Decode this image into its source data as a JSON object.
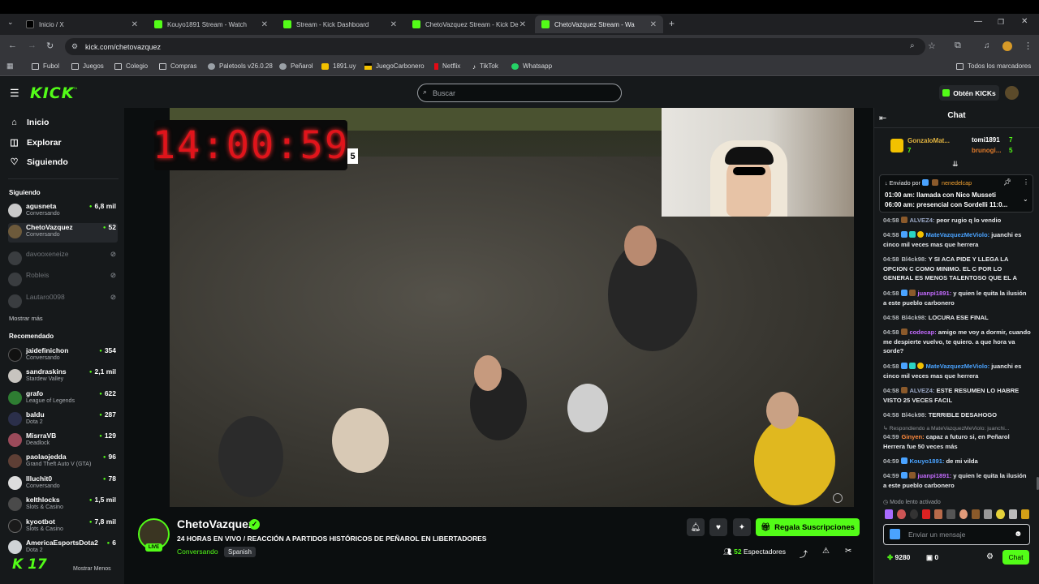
{
  "browser": {
    "tabs": [
      {
        "label": "Inicio / X"
      },
      {
        "label": "Kouyo1891 Stream - Watch"
      },
      {
        "label": "Stream - Kick Dashboard"
      },
      {
        "label": "ChetoVazquez Stream - Kick De"
      },
      {
        "label": "ChetoVazquez Stream - Wa"
      }
    ],
    "url": "kick.com/chetovazquez",
    "bookmarks": [
      "Fubol",
      "Juegos",
      "Colegio",
      "Compras",
      "Paletools v26.0.28",
      "Peñarol",
      "1891.uy",
      "JuegoCarbonero",
      "Netflix",
      "TikTok",
      "Whatsapp"
    ],
    "all_bookmarks": "Todos los marcadores"
  },
  "header": {
    "logo": "KICK",
    "beta": "BETA",
    "search_placeholder": "Buscar",
    "get_kicks": "Obtén KICKs"
  },
  "sidebar": {
    "nav": [
      {
        "label": "Inicio"
      },
      {
        "label": "Explorar"
      },
      {
        "label": "Siguiendo"
      }
    ],
    "following_label": "Siguiendo",
    "following": [
      {
        "name": "agusneta",
        "sub": "Conversando",
        "viewers": "6,8 mil"
      },
      {
        "name": "ChetoVazquez",
        "sub": "Conversando",
        "viewers": "52"
      },
      {
        "name": "davooxeneize",
        "sub": "",
        "viewers": ""
      },
      {
        "name": "Robleis",
        "sub": "",
        "viewers": ""
      },
      {
        "name": "Lautaro0098",
        "sub": "",
        "viewers": ""
      }
    ],
    "show_more": "Mostrar más",
    "recommended_label": "Recomendado",
    "recommended": [
      {
        "name": "jaidefinichon",
        "sub": "Conversando",
        "viewers": "354"
      },
      {
        "name": "sandraskins",
        "sub": "Stardew Valley",
        "viewers": "2,1 mil"
      },
      {
        "name": "grafo",
        "sub": "League of Legends",
        "viewers": "622"
      },
      {
        "name": "baldu",
        "sub": "Dota 2",
        "viewers": "287"
      },
      {
        "name": "MisrraVB",
        "sub": "Deadlock",
        "viewers": "129"
      },
      {
        "name": "paolaojedda",
        "sub": "Grand Theft Auto V (GTA)",
        "viewers": "96"
      },
      {
        "name": "Illuchit0",
        "sub": "Conversando",
        "viewers": "78"
      },
      {
        "name": "kelthlocks",
        "sub": "Slots & Casino",
        "viewers": "1,5 mil"
      },
      {
        "name": "kyootbot",
        "sub": "Slots & Casino",
        "viewers": "7,8 mil"
      },
      {
        "name": "AmericaEsportsDota2",
        "sub": "Dota 2",
        "viewers": "6"
      }
    ],
    "show_less": "Mostrar Menos",
    "kick_counter": "17"
  },
  "video": {
    "clock": "14:00:59",
    "clock_extra": "5"
  },
  "stream": {
    "streamer": "ChetoVazquez",
    "live_badge": "LIVE",
    "title": "24 HORAS EN VIVO / REACCIÓN A PARTIDOS HISTÓRICOS DE PEÑAROL EN LIBERTADORES",
    "category": "Conversando",
    "language": "Spanish",
    "subscribe_label": "Regala Suscripciones",
    "viewers_count": "52",
    "viewers_label": "Espectadores"
  },
  "chat": {
    "title": "Chat",
    "gifters": [
      {
        "name": "GonzaloMat...",
        "count": "7"
      },
      {
        "name": "tomi1891",
        "count": "7"
      },
      {
        "name": "brunogi...",
        "count": "5"
      }
    ],
    "pinned": {
      "sent_by_label": "Enviado por",
      "sent_by": "nenedelcap",
      "line1": "01:00 am: llamada con Nico Musseti",
      "line2": "06:00 am: presencial con Sordelli 11:0..."
    },
    "messages": [
      {
        "time": "04:58",
        "user": "ALVEZ4:",
        "text": "peor rugio q lo vendio",
        "color": "#9aa7c4"
      },
      {
        "time": "04:58",
        "user": "MateVazquezMeViolo:",
        "text": "juanchi es cinco mil veces mas que herrera",
        "color": "#4aa3ff"
      },
      {
        "time": "04:58",
        "user": "Bl4ck98:",
        "text": "Y SI ACA PIDE Y LLEGA LA OPCION C COMO MINIMO. EL C POR LO GENERAL ES MENOS TALENTOSO QUE EL A",
        "color": "#b6babe"
      },
      {
        "time": "04:58",
        "user": "juanpi1891:",
        "text": "y quien le quita la ilusión a este pueblo carbonero",
        "color": "#c46bff"
      },
      {
        "time": "04:58",
        "user": "Bl4ck98:",
        "text": "LOCURA ESE FINAL",
        "color": "#b6babe"
      },
      {
        "time": "04:58",
        "user": "codecap:",
        "text": "amigo me voy a dormir, cuando me despierte vuelvo, te quiero. a que hora va sorde?",
        "color": "#c46bff"
      },
      {
        "time": "04:58",
        "user": "MateVazquezMeViolo:",
        "text": "juanchi es cinco mil veces mas que herrera",
        "color": "#4aa3ff"
      },
      {
        "time": "04:58",
        "user": "ALVEZ4:",
        "text": "ESTE RESUMEN LO HABRE VISTO 25 VECES FACIL",
        "color": "#9aa7c4"
      },
      {
        "time": "04:58",
        "user": "Bl4ck98:",
        "text": "TERRIBLE DESAHOGO",
        "color": "#b6babe"
      },
      {
        "time": "04:59",
        "user": "Ginyen:",
        "text": "capaz a futuro si, en Peñarol Herrera fue 50 veces más",
        "color": "#ff8a3d",
        "reply": "Respondiendo a MateVazquezMeViolo: juanchi..."
      },
      {
        "time": "04:59",
        "user": "Kouyo1891:",
        "text": "de mi vilda",
        "color": "#4aa3ff"
      },
      {
        "time": "04:59",
        "user": "juanpi1891:",
        "text": "y quien le quita la ilusión a este pueblo carbonero",
        "color": "#c46bff"
      }
    ],
    "slow_mode": "Modo lento activado",
    "input_placeholder": "Enviar un mensaje",
    "points": "9280",
    "other_count": "0",
    "send_label": "Chat"
  },
  "colors": {
    "accent": "#53fc18",
    "bg": "#0b0e0f",
    "panel": "#16191b"
  }
}
